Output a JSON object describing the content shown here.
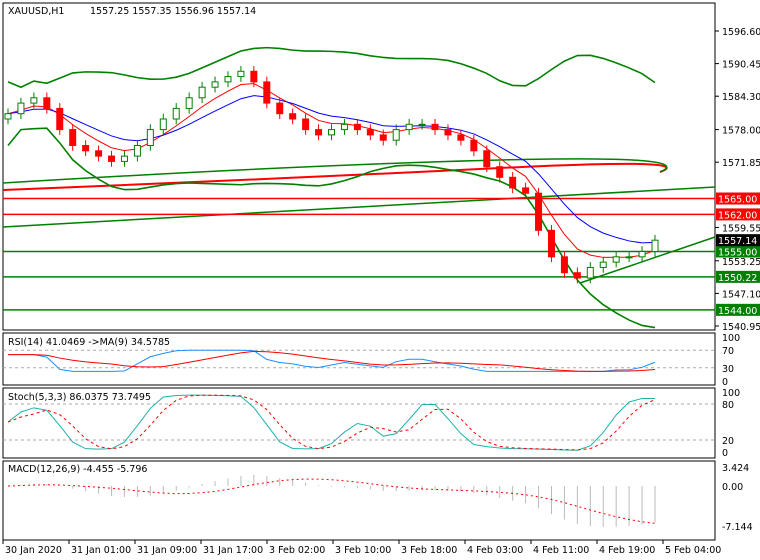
{
  "header": {
    "symbol": "XAUUSD,H1",
    "ohlc": "1557.25 1557.35 1556.96 1557.14"
  },
  "chart_data": [
    {
      "type": "candlestick",
      "title": "XAUUSD,H1",
      "price_ticks": [
        "1596.60",
        "1590.45",
        "1584.30",
        "1578.00",
        "1571.85",
        "1559.55",
        "1553.25",
        "1547.10",
        "1540.95"
      ],
      "ylim": [
        1540.95,
        1596.6
      ],
      "closes": [
        1581,
        1583,
        1584,
        1582,
        1578,
        1575,
        1574,
        1573,
        1572,
        1573,
        1575,
        1578,
        1580,
        1582,
        1584,
        1586,
        1587,
        1588,
        1589,
        1587,
        1583,
        1581,
        1580,
        1578,
        1577,
        1578,
        1579,
        1578,
        1577,
        1576,
        1578,
        1579,
        1579,
        1578,
        1577,
        1576,
        1574,
        1571,
        1569,
        1567,
        1566,
        1559,
        1554,
        1551,
        1550,
        1552,
        1553,
        1554,
        1554,
        1555,
        1557.14
      ],
      "levels": [
        {
          "value": 1565.0,
          "label": "1565.00",
          "color": "#ff0000"
        },
        {
          "value": 1562.0,
          "label": "1562.00",
          "color": "#ff0000"
        },
        {
          "value": 1555.0,
          "label": "1555.00",
          "color": "#008000"
        },
        {
          "value": 1550.22,
          "label": "1550.22",
          "color": "#008000"
        },
        {
          "value": 1544.0,
          "label": "1544.00",
          "color": "#008000"
        }
      ],
      "current": {
        "value": 1557.14,
        "label": "1557.14"
      },
      "x_labels": [
        "30 Jan 2020",
        "31 Jan 01:00",
        "31 Jan 09:00",
        "31 Jan 17:00",
        "3 Feb 02:00",
        "3 Feb 10:00",
        "3 Feb 18:00",
        "4 Feb 03:00",
        "4 Feb 11:00",
        "4 Feb 19:00",
        "5 Feb 04:00"
      ]
    },
    {
      "type": "line",
      "title": "RSI(14) 41.0469  ->MA(9) 34.5785",
      "ticks": [
        "100",
        "70",
        "30",
        "0"
      ],
      "ylim": [
        0,
        100
      ]
    },
    {
      "type": "line",
      "title": "Stoch(5,3,3) 86.0375 73.7495",
      "ticks": [
        "100",
        "80",
        "20",
        "0"
      ],
      "ylim": [
        0,
        100
      ]
    },
    {
      "type": "bar",
      "title": "MACD(12,26,9) -4.455 -5.796",
      "ticks": [
        "3.424",
        "0.00",
        "-7.144"
      ],
      "ylim": [
        -7.144,
        3.424
      ]
    }
  ],
  "colors": {
    "up": "#008000",
    "down": "#ff0000",
    "blue": "#0000ff",
    "rsi": "#1e90ff",
    "stoch": "#20b2aa"
  }
}
